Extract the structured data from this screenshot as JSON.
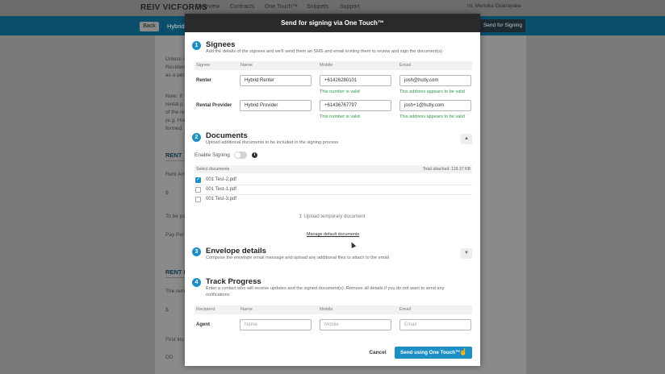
{
  "background_app": {
    "logo": "REIV VICFORMS",
    "nav": [
      "Overview",
      "Contracts",
      "One Touch™",
      "Snippets",
      "Support"
    ],
    "user": "Hi, Menuka Ekanayake",
    "back_label": "Back",
    "doc_title": "Hybrid",
    "send_label": "Send for Signing",
    "snippets": [
      "Unless i",
      "Resident",
      "as a per",
      "Note: If",
      "rental p",
      "of the re",
      "(e.g. Hoi",
      "formed",
      "RENT",
      "Rent Am",
      "$",
      "To be pa",
      "Pay Per",
      "RENT I",
      "The rem",
      "$",
      "First ins",
      "DD"
    ]
  },
  "modal": {
    "title": "Send for signing via One Touch™",
    "signees": {
      "number": "1",
      "title": "Signees",
      "description": "Add the details of the signees and we'll send them an SMS and email inviting them to review and sign the document(s)",
      "columns": [
        "Signee",
        "Name",
        "Mobile",
        "Email"
      ],
      "rows": [
        {
          "role": "Renter",
          "name": "Hybrid Renter",
          "mobile": "+61426280101",
          "email": "josh@hutly.com",
          "mobile_status": "This number is valid",
          "email_status": "This address appears to be valid"
        },
        {
          "role": "Rental Provider",
          "name": "Hybrid Provider",
          "mobile": "+61436767797",
          "email": "josh+1@hutly.com",
          "mobile_status": "This number is valid",
          "email_status": "This address appears to be valid"
        }
      ]
    },
    "documents": {
      "number": "2",
      "title": "Documents",
      "description": "Upload additional documents to be included in the signing process",
      "enable_signing_label": "Enable Signing",
      "enable_signing_on": false,
      "select_label": "Select documents",
      "total_attached": "Total attached: 119.37 KB",
      "files": [
        {
          "name": "001 Test-2.pdf",
          "checked": true
        },
        {
          "name": "001 Test-1.pdf",
          "checked": false
        },
        {
          "name": "001 Test-3.pdf",
          "checked": false
        }
      ],
      "upload_label": "Upload temporary document",
      "manage_label": "Manage default documents"
    },
    "envelope": {
      "number": "3",
      "title": "Envelope details",
      "description": "Compose the envelope email message and upload any additional files to attach to the email"
    },
    "track": {
      "number": "4",
      "title": "Track Progress",
      "description_1": "Enter a contact who will receive updates and the signed document(s). Remove all details if you do not want to send any",
      "description_2": "notifications",
      "columns": [
        "Recipient",
        "Name",
        "Mobile",
        "Email"
      ],
      "row_label": "Agent",
      "name_placeholder": "Name",
      "mobile_placeholder": "Mobile",
      "email_placeholder": "Email"
    },
    "footer": {
      "cancel_label": "Cancel",
      "send_label": "Send using One Touch™"
    }
  },
  "colors": {
    "accent": "#1e8fc4",
    "valid": "#2b9a45",
    "header": "#2a2a2a"
  }
}
